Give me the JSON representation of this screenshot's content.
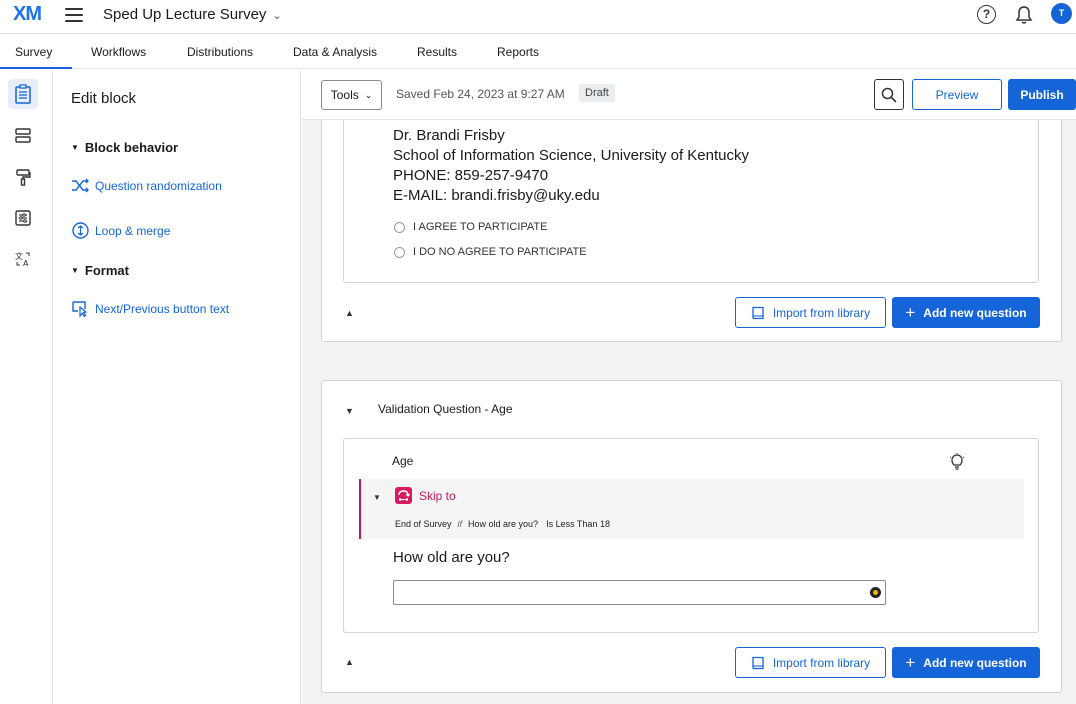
{
  "app": {
    "logo": "XM",
    "survey_title": "Sped Up Lecture Survey",
    "help_label": "?",
    "avatar_initial": "T"
  },
  "nav": {
    "tabs": [
      "Survey",
      "Workflows",
      "Distributions",
      "Data & Analysis",
      "Results",
      "Reports"
    ],
    "active": "Survey"
  },
  "panel": {
    "title": "Edit block",
    "sections": [
      {
        "label": "Block behavior",
        "links": [
          "Question randomization",
          "Loop & merge"
        ]
      },
      {
        "label": "Format",
        "links": [
          "Next/Previous button text"
        ]
      }
    ]
  },
  "toolbar": {
    "tools_label": "Tools",
    "saved_text": "Saved Feb 24, 2023 at 9:27 AM",
    "status_badge": "Draft",
    "preview_label": "Preview",
    "publish_label": "Publish"
  },
  "consent_block": {
    "lines": [
      "Dr. Brandi Frisby",
      "School of Information Science, University of Kentucky",
      "PHONE: 859-257-9470",
      "E-MAIL: brandi.frisby@uky.edu"
    ],
    "choices": [
      "I AGREE TO PARTICIPATE",
      "I DO NO AGREE TO PARTICIPATE"
    ],
    "import_label": "Import from library",
    "add_label": "Add new question"
  },
  "validation_block": {
    "title": "Validation Question - Age",
    "question_label": "Age",
    "skip": {
      "title": "Skip to",
      "destination": "End of Survey",
      "if_word": "if",
      "question": "How old are you?",
      "condition": "Is Less Than 18"
    },
    "question_text": "How old are you?",
    "import_label": "Import from library",
    "add_label": "Add new question"
  },
  "colors": {
    "accent": "#1565d8",
    "skip_logic": "#c2185b"
  }
}
